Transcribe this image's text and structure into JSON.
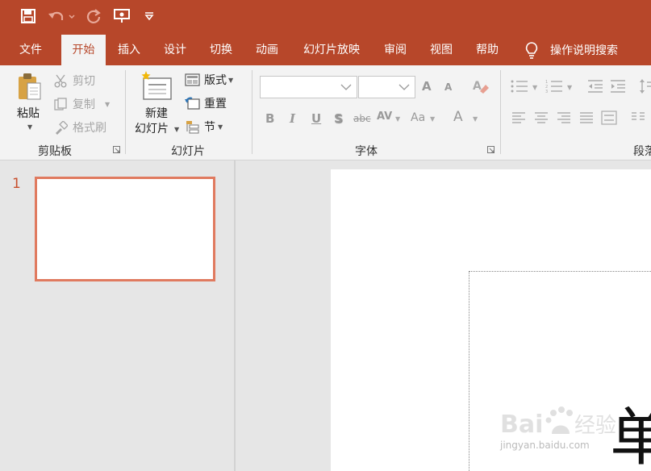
{
  "colors": {
    "accent": "#b7472a",
    "ribbon_bg": "#f3f3f3",
    "thumb_border": "#e07a5f"
  },
  "quick_access": {
    "save": "save-icon",
    "undo": "undo-icon",
    "redo": "redo-icon",
    "present": "present-from-start-icon",
    "customize": "customize-qat-icon"
  },
  "tabs": [
    {
      "label": "文件"
    },
    {
      "label": "开始",
      "active": true
    },
    {
      "label": "插入"
    },
    {
      "label": "设计"
    },
    {
      "label": "切换"
    },
    {
      "label": "动画"
    },
    {
      "label": "幻灯片放映"
    },
    {
      "label": "审阅"
    },
    {
      "label": "视图"
    },
    {
      "label": "帮助"
    }
  ],
  "tell_me": {
    "label": "操作说明搜索",
    "icon": "lightbulb-icon"
  },
  "ribbon": {
    "clipboard": {
      "label": "剪贴板",
      "paste": "粘贴",
      "cut": "剪切",
      "copy": "复制",
      "format_painter": "格式刷"
    },
    "slides": {
      "label": "幻灯片",
      "new_slide_line1": "新建",
      "new_slide_line2": "幻灯片",
      "layout": "版式",
      "reset": "重置",
      "section": "节"
    },
    "font": {
      "label": "字体",
      "bold": "B",
      "italic": "I",
      "underline": "U",
      "shadow": "S",
      "strike": "abc",
      "spacing": "AV",
      "case": "Aa",
      "color": "A",
      "grow": "A",
      "shrink": "A"
    },
    "paragraph": {
      "label": "段落"
    }
  },
  "thumbnail_pane": {
    "slide_number": "1"
  },
  "slide": {
    "big_char": "单"
  },
  "watermark": {
    "text": "Baidu经验",
    "url_text": "jingyan.baidu.com"
  }
}
